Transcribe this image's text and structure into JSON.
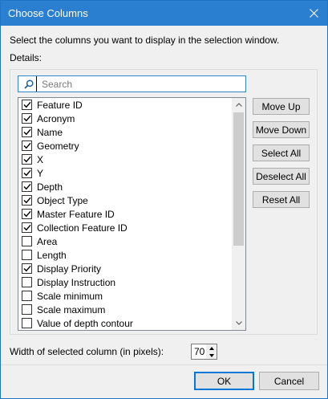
{
  "window": {
    "title": "Choose Columns"
  },
  "intro_text": "Select the columns you want to display in the selection window.",
  "details_label": "Details:",
  "search": {
    "placeholder": "Search",
    "value": ""
  },
  "columns": [
    {
      "label": "Feature ID",
      "checked": true
    },
    {
      "label": "Acronym",
      "checked": true
    },
    {
      "label": "Name",
      "checked": true
    },
    {
      "label": "Geometry",
      "checked": true
    },
    {
      "label": "X",
      "checked": true
    },
    {
      "label": "Y",
      "checked": true
    },
    {
      "label": "Depth",
      "checked": true
    },
    {
      "label": "Object Type",
      "checked": true
    },
    {
      "label": "Master Feature ID",
      "checked": true
    },
    {
      "label": "Collection Feature ID",
      "checked": true
    },
    {
      "label": "Area",
      "checked": false
    },
    {
      "label": "Length",
      "checked": false
    },
    {
      "label": "Display Priority",
      "checked": true
    },
    {
      "label": "Display Instruction",
      "checked": false
    },
    {
      "label": "Scale minimum",
      "checked": false
    },
    {
      "label": "Scale maximum",
      "checked": false
    },
    {
      "label": "Value of depth contour",
      "checked": false
    }
  ],
  "side_buttons": {
    "move_up": "Move Up",
    "move_down": "Move Down",
    "select_all": "Select All",
    "deselect_all": "Deselect All",
    "reset_all": "Reset All"
  },
  "width_setting": {
    "label": "Width of selected column (in pixels):",
    "value": "70"
  },
  "footer": {
    "ok": "OK",
    "cancel": "Cancel"
  },
  "colors": {
    "title_bar": "#2b7fd0",
    "focus_border": "#0078d7"
  },
  "icons": {
    "search": "search-icon",
    "close": "close-icon",
    "scroll_up": "chevron-up-icon",
    "scroll_down": "chevron-down-icon"
  }
}
